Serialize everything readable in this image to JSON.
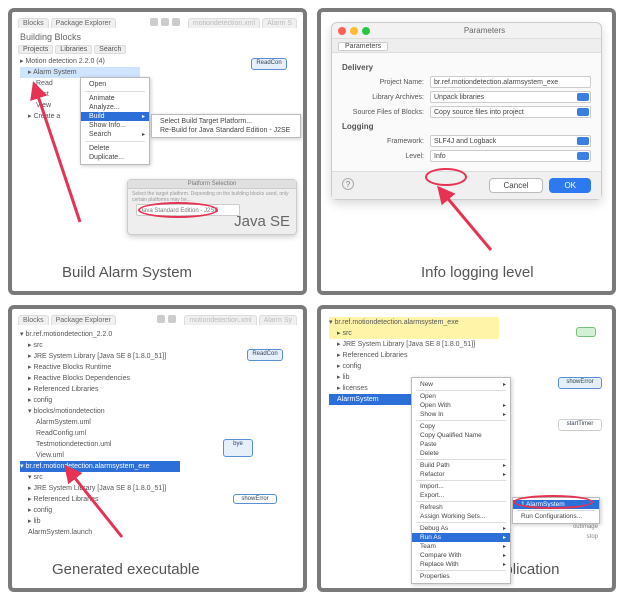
{
  "captions": {
    "p1": "Build Alarm System",
    "p2": "Info logging level",
    "p3": "Generated executable",
    "p4": "Run the application"
  },
  "p1": {
    "tabs": [
      "Blocks",
      "Package Explorer"
    ],
    "faded_tabs": [
      "motiondetection.xml",
      "Alarm S"
    ],
    "building_blocks": "Building Blocks",
    "subtabs": [
      "Projects",
      "Libraries",
      "Search"
    ],
    "tree": {
      "root": "Motion detection 2.2.0 (4)",
      "selected": "Alarm System",
      "children": [
        "Read",
        "Test",
        "View",
        "Create a"
      ]
    },
    "ctx": {
      "open": "Open",
      "animate": "Animate",
      "analyze": "Analyze...",
      "build": "Build",
      "showinfo": "Show Info...",
      "search": "Search",
      "delete": "Delete",
      "duplicate": "Duplicate..."
    },
    "submenu": {
      "a": "Select Build Target Platform...",
      "b": "Re-Build for Java Standard Edition - J2SE"
    },
    "diagram_label": "ReadCon",
    "popup": {
      "title": "Platform Selection",
      "hint": "Select the target platform. Depending on the building blocks used, only certain platforms may be...",
      "field": "Java Standard Edition - J2SE",
      "label": "Java SE"
    }
  },
  "p2": {
    "title": "Parameters",
    "tab": "Parameters",
    "delivery": "Delivery",
    "project_name_lbl": "Project Name:",
    "project_name_val": "br.ref.motiondetection.alarmsystem_exe",
    "library_lbl": "Library Archives:",
    "library_val": "Unpack libraries",
    "source_lbl": "Source Files of Blocks:",
    "source_val": "Copy source files into project",
    "logging": "Logging",
    "framework_lbl": "Framework:",
    "framework_val": "SLF4J and Logback",
    "level_lbl": "Level:",
    "level_val": "Info",
    "cancel": "Cancel",
    "ok": "OK"
  },
  "p3": {
    "tabs": [
      "Blocks",
      "Package Explorer"
    ],
    "faded_tabs": [
      "motiondetection.xml",
      "Alarm Sy"
    ],
    "tree": [
      "br.ref.motiondetection_2.2.0",
      "src",
      "JRE System Library [Java SE 8 [1.8.0_51]]",
      "Reactive Blocks Runtime",
      "Reactive Blocks Dependencies",
      "Referenced Libraries",
      "config",
      "blocks/motiondetection",
      "AlarmSystem.uml",
      "ReadConfig.uml",
      "Testmotiondetection.uml",
      "View.uml",
      "br.ref.motiondetection.alarmsystem_exe",
      "src",
      "JRE System Library [Java SE 8 [1.8.0_51]]",
      "Referenced Libraries",
      "config",
      "lib",
      "AlarmSystem.launch"
    ],
    "selected": "br.ref.motiondetection.alarmsystem_exe",
    "diag": {
      "readcon": "ReadCon",
      "bye": "bye",
      "showerror": "showError"
    }
  },
  "p4": {
    "tree": [
      "br.ref.motiondetection.alarmsystem_exe",
      "src",
      "JRE System Library [Java SE 8 [1.8.0_51]]",
      "Referenced Libraries",
      "config",
      "lib",
      "licenses",
      "AlarmSystem"
    ],
    "selected": "AlarmSystem",
    "menu": [
      "New",
      "Open",
      "Open With",
      "Show In",
      "Copy",
      "Copy Qualified Name",
      "Paste",
      "Delete",
      "Build Path",
      "Refactor",
      "Import...",
      "Export...",
      "Refresh",
      "Assign Working Sets...",
      "Debug As",
      "Run As",
      "Team",
      "Compare With",
      "Replace With",
      "Properties"
    ],
    "runas_sub": "1 AlarmSystem",
    "runconfig": "Run Configurations...",
    "diag": {
      "showerror": "showError",
      "starttimer": "startTimer",
      "outimage": "outImage",
      "stop": "stop"
    }
  }
}
